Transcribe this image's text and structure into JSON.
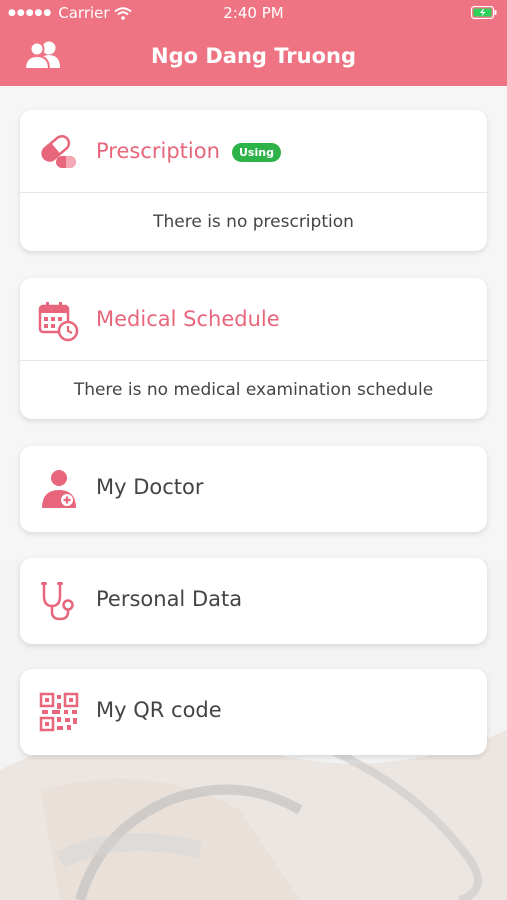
{
  "status_bar": {
    "carrier": "Carrier",
    "time": "2:40 PM"
  },
  "header": {
    "title": "Ngo Dang Truong"
  },
  "cards": {
    "prescription": {
      "label": "Prescription",
      "badge": "Using",
      "empty_text": "There is no prescription"
    },
    "schedule": {
      "label": "Medical Schedule",
      "empty_text": "There is no medical examination schedule"
    },
    "doctor": {
      "label": "My Doctor"
    },
    "personal": {
      "label": "Personal Data"
    },
    "qr": {
      "label": "My QR code"
    }
  },
  "colors": {
    "accent": "#ef7483",
    "icon": "#e8667b",
    "badge": "#2db34a"
  }
}
